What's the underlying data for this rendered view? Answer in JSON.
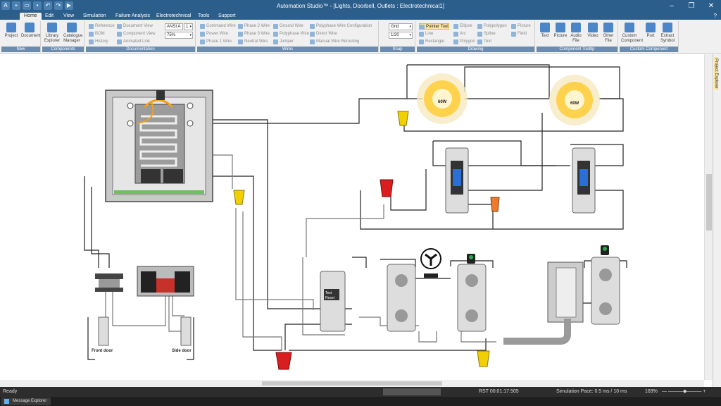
{
  "app": {
    "title": "Automation Studio™ - [Lights, Doorbell, Outlets : Electrotechnical1]"
  },
  "tabs": [
    "Home",
    "Edit",
    "View",
    "Simulation",
    "Failure Analysis",
    "Electrotechnical",
    "Tools",
    "Support"
  ],
  "ribbon": {
    "new": {
      "label": "New",
      "project": "Project",
      "document": "Document"
    },
    "components": {
      "label": "Components",
      "library": "Library Explorer",
      "catalogue": "Catalogue Manager"
    },
    "documentation": {
      "label": "Documentation",
      "reference": "Reference",
      "document_view": "Document View",
      "bom": "BOM",
      "component_view": "Component View",
      "history": "History",
      "animated_link": "Animated Link",
      "ansi_value": "ANSI A",
      "ansi_num": "1",
      "zoom_value": "75%"
    },
    "wires": {
      "label": "Wires",
      "command": "Command Wire",
      "phase2": "Phase 2 Wire",
      "ground": "Ground Wire",
      "polyphase_conf": "Polyphase Wire Configuration",
      "power": "Power Wire",
      "phase3": "Phase 3 Wire",
      "polyphase": "Polyphase Wire",
      "direct": "Direct Wire",
      "phase1": "Phase 1 Wire",
      "neutral": "Neutral Wire",
      "jumper": "Jumper",
      "manual": "Manual Wire Rerouting"
    },
    "snap": {
      "label": "Snap",
      "grid": "Grid",
      "grid_value": "1/20"
    },
    "drawing": {
      "label": "Drawing",
      "pointer": "Pointer Tool",
      "ellipse": "Ellipse",
      "polypolygon": "Polypolygon",
      "picture": "Picture",
      "line": "Line",
      "arc": "Arc",
      "spline": "Spline",
      "field": "Field",
      "rectangle": "Rectangle",
      "polygon": "Polygon",
      "text": "Text"
    },
    "tooltip": {
      "label": "Component Tooltip",
      "text": "Text",
      "picture": "Picture",
      "audio": "Audio File",
      "video": "Video",
      "other": "Other File"
    },
    "custom": {
      "label": "Custom Component",
      "custom": "Custom Component",
      "port": "Port",
      "extract": "Extract Symbol"
    }
  },
  "canvas": {
    "bulb_label": "60W",
    "gfci_test": "Test",
    "gfci_reset": "Reset",
    "front_door": "Front door",
    "side_door": "Side door",
    "colors": {
      "wire": "#222222",
      "gray_wire": "#777777",
      "bulb_glow": "#ffd24d",
      "wirenut_yellow": "#f2d000",
      "wirenut_red": "#d81e1e",
      "wirenut_orange": "#f07a2a",
      "switch_blue": "#2b6fd6"
    }
  },
  "side_panel": {
    "project_explorer": "Project Explorer"
  },
  "status": {
    "ready": "Ready",
    "rst": "RST 00:01:17.505",
    "pace": "Simulation Pace: 0.5 ms / 10 ms",
    "zoom": "169%"
  },
  "bottom": {
    "message_explorer": "Message Explorer"
  }
}
